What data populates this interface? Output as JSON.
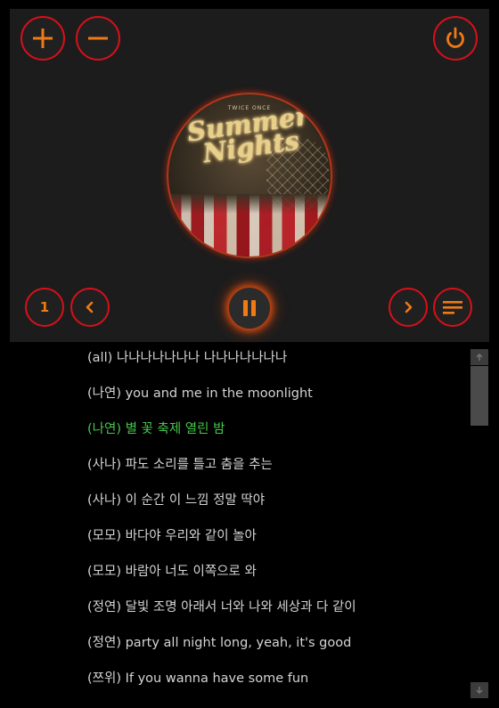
{
  "player": {
    "album_art": {
      "label_text": "TWICE ONCE",
      "title_line1": "Summer",
      "title_line2": "Nights"
    },
    "controls": {
      "add": "plus-icon",
      "remove": "minus-icon",
      "power": "power-icon",
      "repeat_one_label": "1",
      "previous": "chevron-left-icon",
      "play_pause": "pause-icon",
      "next": "chevron-right-icon",
      "playlist": "menu-icon"
    },
    "accent_color": "#f07a16",
    "border_color": "#d8101a"
  },
  "lyrics": [
    {
      "text": "(all)  나나나나나나나 나나나나나나나",
      "current": false
    },
    {
      "text": "(나연)  you and me in the moonlight",
      "current": false
    },
    {
      "text": "(나연) 별 꽃 축제 열린 밤",
      "current": true
    },
    {
      "text": "(사나)  파도 소리를 틀고 춤을 추는",
      "current": false
    },
    {
      "text": "(사나) 이 순간 이 느낌 정말 딱야",
      "current": false
    },
    {
      "text": "(모모)  바다야 우리와 같이 놀아",
      "current": false
    },
    {
      "text": "(모모) 바람아 너도 이쪽으로 와",
      "current": false
    },
    {
      "text": "(정연)  달빛 조명 아래서 너와 나와 세상과 다 같이",
      "current": false
    },
    {
      "text": "(정연) party all night long, yeah, it's good",
      "current": false
    },
    {
      "text": "(쯔위)  If you wanna have some fun",
      "current": false
    }
  ],
  "colors": {
    "lyric_text": "#d4d4d4",
    "lyric_current": "#45c84a"
  }
}
